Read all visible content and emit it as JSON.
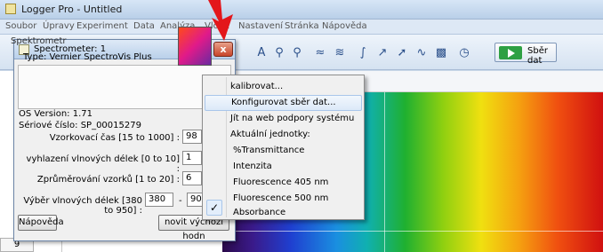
{
  "app": {
    "title": "Logger Pro - Untitled",
    "menu": [
      "Soubor",
      "Úpravy",
      "Experiment",
      "Data",
      "Analýza",
      "Vložit",
      "Nastavení",
      "Stránka",
      "Nápověda"
    ],
    "collect_label": "Sběr dat"
  },
  "toolbar": {
    "icons": [
      "autoscale-icon",
      "zoom-in-icon",
      "zoom-out-icon",
      "examine-icon",
      "stats-icon",
      "integral-icon",
      "tangent-icon",
      "linear-fit-icon",
      "curve-fit-icon",
      "fft-icon",
      "histogram-icon",
      "replay-icon"
    ]
  },
  "dialog": {
    "title": "Spectrometer: 1",
    "close_label": "x",
    "device_label": "Spektrometr",
    "device_type": "Type: Vernier SpectroVis Plus",
    "os_version": "OS Version: 1.71",
    "serial": "Sériové číslo: SP_00015279",
    "fields": {
      "sample_time_label": "Vzorkovací čas [15 to 1000] :",
      "sample_time_value": "98",
      "smoothing_label": "vyhlazení vlnových délek [0 to 10] :",
      "smoothing_value": "1",
      "averaging_label": "Zprůměrování vzorků [1 to 20] :",
      "averaging_value": "6",
      "wavelength_label": "Výběr vlnových délek [380 to 950] :",
      "wavelength_from": "380",
      "wavelength_sep": "-",
      "wavelength_to": "900"
    },
    "help_button": "Nápověda",
    "reset_button": "novit výchozí hodn"
  },
  "context_menu": {
    "items": [
      {
        "label": "kalibrovat...",
        "highlighted": false
      },
      {
        "label": "Konfigurovat sběr dat...",
        "highlighted": true
      },
      {
        "label": "Jít na web podpory systému",
        "highlighted": false
      },
      {
        "label": "Aktuální jednotky:",
        "highlighted": false
      },
      {
        "label": "%Transmittance",
        "highlighted": false
      },
      {
        "label": "Intenzita",
        "highlighted": false
      },
      {
        "label": "Fluorescence 405 nm",
        "highlighted": false
      },
      {
        "label": "Fluorescence 500 nm",
        "highlighted": false
      },
      {
        "label": "Absorbance",
        "highlighted": false,
        "checked": true
      }
    ],
    "check_mark": "✓"
  },
  "table": {
    "row_number": "9"
  },
  "colors": {
    "arrow": "#e3161b",
    "highlight_border": "#a9c6ea",
    "collect_green": "#2ea043"
  }
}
